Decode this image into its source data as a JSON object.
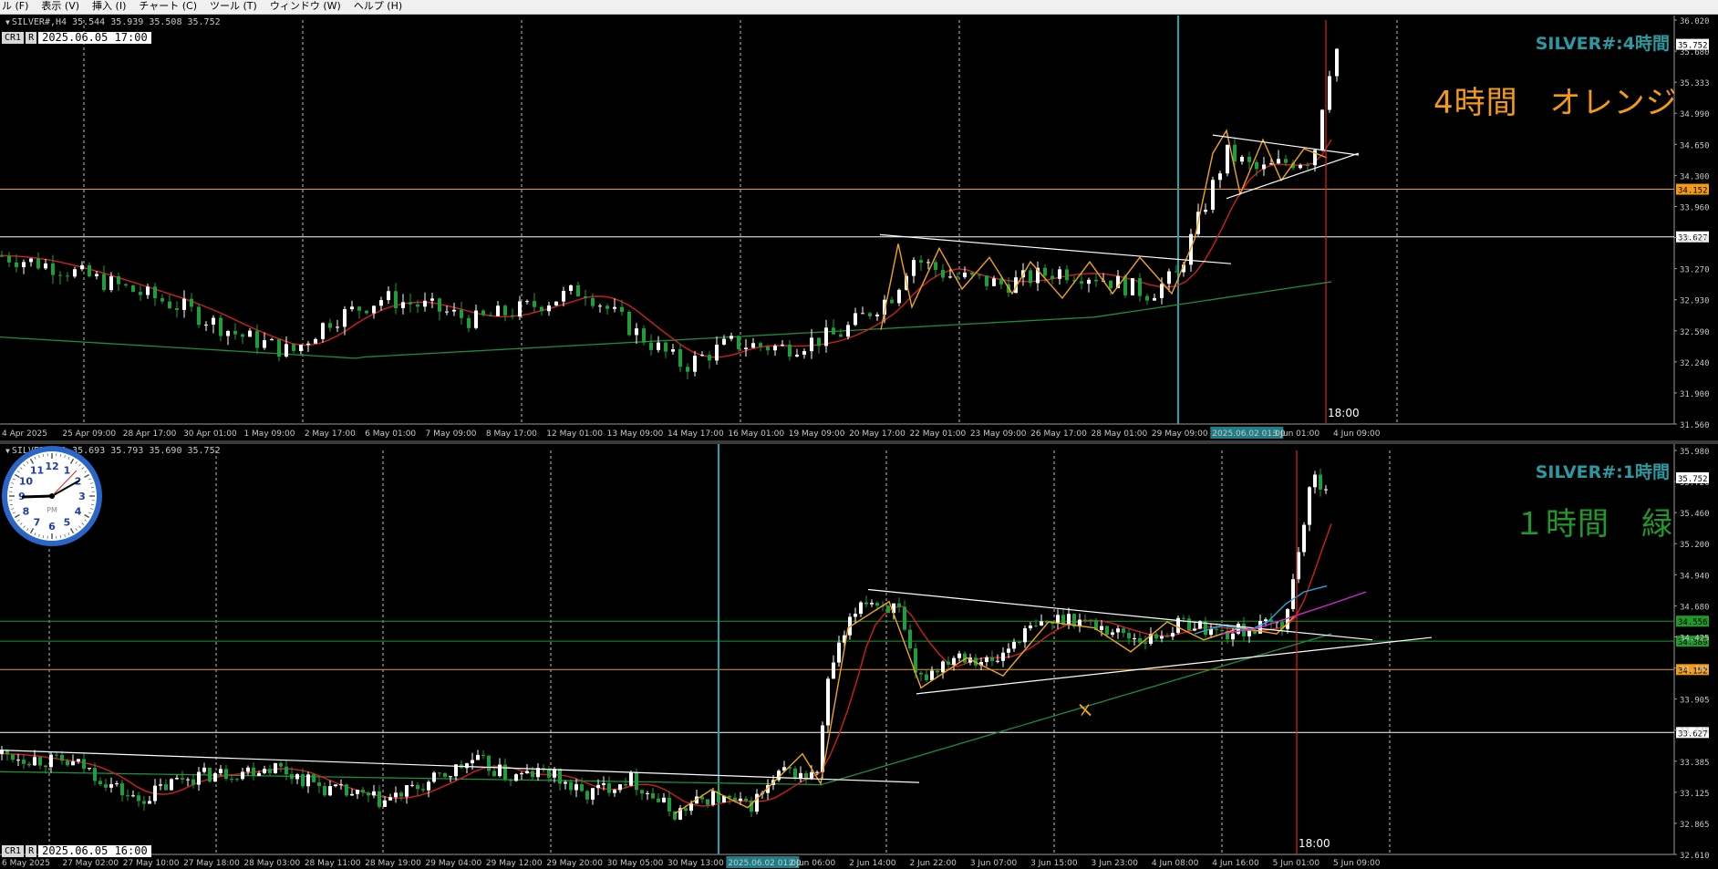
{
  "menu": [
    "ル (F)",
    "表示 (V)",
    "挿入 (I)",
    "チャート (C)",
    "ツール (T)",
    "ウィンドウ (W)",
    "ヘルプ (H)"
  ],
  "charts": [
    {
      "id": "h4",
      "header": "SILVER#,H4  35.544 35.939 35.508 35.752",
      "tag_cr": "CR1",
      "tag_r": "R",
      "datetime": "2025.06.05 17:00",
      "symbol_label": "SILVER#:4時間",
      "annotation": "4時間　オレンジ",
      "annotation_color": "#f39a16",
      "price_ticks": [
        "36.020",
        "35.680",
        "35.333",
        "34.990",
        "34.650",
        "34.300",
        "33.960",
        "33.620",
        "33.270",
        "32.930",
        "32.590",
        "32.240",
        "31.900",
        "31.560"
      ],
      "price_min": 31.56,
      "price_max": 36.02,
      "current_price": "35.752",
      "hlines": [
        {
          "price": 34.152,
          "label": "34.152",
          "color": "#f39a16"
        },
        {
          "price": 33.627,
          "label": "33.627",
          "color": "#ffffff"
        }
      ],
      "time_labels": [
        "4 Apr 2025",
        "25 Apr 09:00",
        "28 Apr 17:00",
        "30 Apr 01:00",
        "1 May 09:00",
        "2 May 17:00",
        "6 May 01:00",
        "7 May 09:00",
        "8 May 17:00",
        "12 May 01:00",
        "13 May 09:00",
        "14 May 17:00",
        "16 May 01:00",
        "19 May 09:00",
        "20 May 17:00",
        "22 May 01:00",
        "23 May 09:00",
        "26 May 17:00",
        "28 May 01:00",
        "29 May 09:00",
        "2025.06.02 01:00",
        "3 Jun 01:00",
        "4 Jun 09:00"
      ],
      "cursor_time": "18:00",
      "colors": {
        "bull": "#1e9e3a",
        "bear": "#ffffff",
        "ma_red": "#d01f1f",
        "ma_green": "#1a8f3c",
        "zigzag": "#f3a416",
        "trend": "#ffffff",
        "vline": "#1aa6b0",
        "cursor": "#e02020"
      }
    },
    {
      "id": "h1",
      "header": "SILVER#,H1  35.693 35.793 35.690 35.752",
      "tag_cr": "CR1",
      "tag_r": "R",
      "datetime": "2025.06.05 16:00",
      "symbol_label": "SILVER#:1時間",
      "annotation": "１時間　緑",
      "annotation_color": "#1f9a2a",
      "price_ticks": [
        "35.980",
        "35.720",
        "35.460",
        "35.200",
        "34.940",
        "34.680",
        "34.425",
        "34.165",
        "33.905",
        "33.645",
        "33.385",
        "33.125",
        "32.865",
        "32.610"
      ],
      "price_min": 32.61,
      "price_max": 35.98,
      "current_price": "35.752",
      "hlines": [
        {
          "price": 34.556,
          "label": "34.556",
          "color": "#1f9a2a"
        },
        {
          "price": 34.389,
          "label": "34.389",
          "color": "#1f9a2a"
        },
        {
          "price": 34.152,
          "label": "34.152",
          "color": "#f39a16"
        },
        {
          "price": 33.627,
          "label": "33.627",
          "color": "#ffffff"
        }
      ],
      "time_labels": [
        "6 May 2025",
        "27 May 02:00",
        "27 May 10:00",
        "27 May 18:00",
        "28 May 03:00",
        "28 May 11:00",
        "28 May 19:00",
        "29 May 04:00",
        "29 May 12:00",
        "29 May 20:00",
        "30 May 05:00",
        "30 May 13:00",
        "2025.06.02 01:00",
        "2 Jun 06:00",
        "2 Jun 14:00",
        "2 Jun 22:00",
        "3 Jun 07:00",
        "3 Jun 15:00",
        "3 Jun 23:00",
        "4 Jun 08:00",
        "4 Jun 16:00",
        "5 Jun 01:00",
        "5 Jun 09:00"
      ],
      "cursor_time": "18:00",
      "colors": {
        "bull": "#1e9e3a",
        "bear": "#ffffff",
        "ma_red": "#d01f1f",
        "ma_green": "#1a8f3c",
        "zigzag": "#f3a416",
        "trend": "#ffffff",
        "vline": "#1aa6b0",
        "cursor": "#e02020",
        "cyan": "#2aa7e0",
        "magenta": "#d12ad1"
      }
    }
  ],
  "clock": {
    "label": "PM",
    "numbers": [
      "12",
      "1",
      "2",
      "3",
      "4",
      "5",
      "6",
      "7",
      "8",
      "9",
      "10",
      "11"
    ]
  }
}
